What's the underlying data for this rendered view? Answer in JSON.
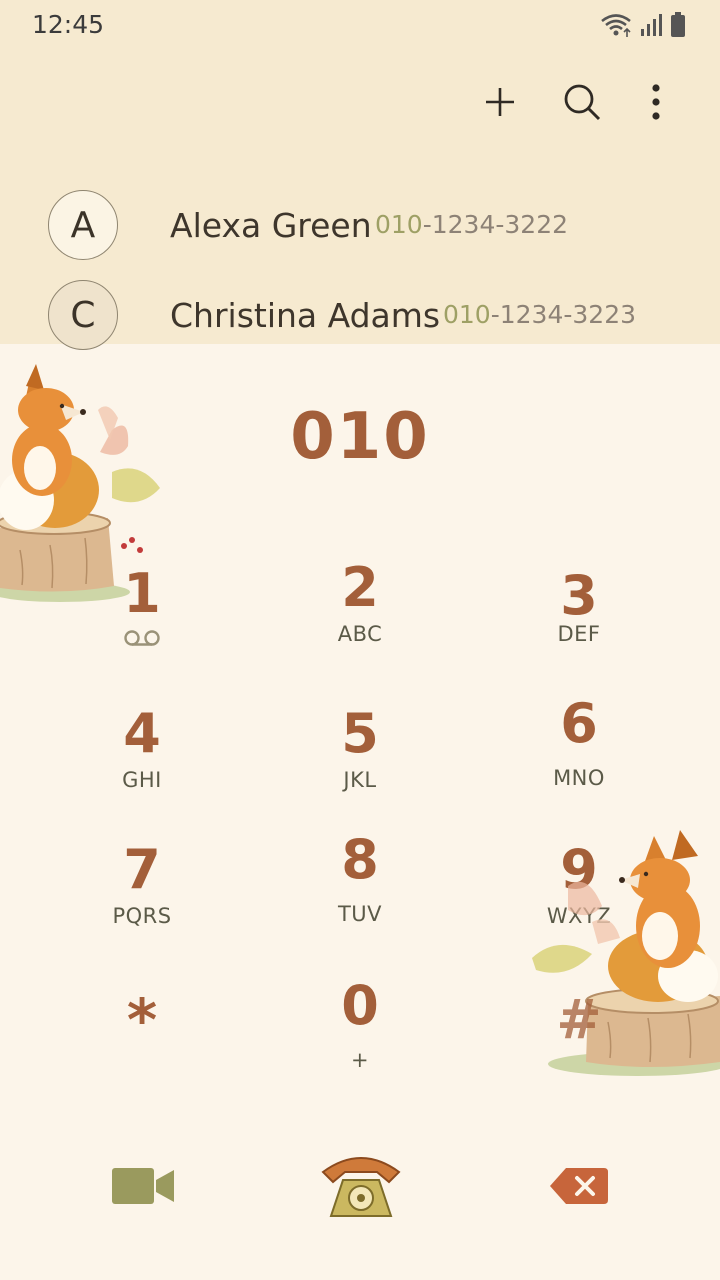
{
  "status_bar": {
    "time": "12:45",
    "icons": [
      "wifi-icon",
      "signal-icon",
      "battery-icon"
    ]
  },
  "toolbar": {
    "icons": [
      "add-icon",
      "search-icon",
      "more-vert-icon"
    ]
  },
  "contacts": [
    {
      "initial": "A",
      "name": "Alexa Green",
      "number_match": "010",
      "number_rest": "-1234-3222"
    },
    {
      "initial": "C",
      "name": "Christina Adams",
      "number_match": "010",
      "number_rest": "-1234-3223"
    }
  ],
  "dialer": {
    "display": "010",
    "keys": [
      {
        "digit": "1",
        "letters": ""
      },
      {
        "digit": "2",
        "letters": "ABC"
      },
      {
        "digit": "3",
        "letters": "DEF"
      },
      {
        "digit": "4",
        "letters": "GHI"
      },
      {
        "digit": "5",
        "letters": "JKL"
      },
      {
        "digit": "6",
        "letters": "MNO"
      },
      {
        "digit": "7",
        "letters": "PQRS"
      },
      {
        "digit": "8",
        "letters": "TUV"
      },
      {
        "digit": "9",
        "letters": "WXYZ"
      },
      {
        "digit": "*",
        "letters": ""
      },
      {
        "digit": "0",
        "letters": "+"
      },
      {
        "digit": "#",
        "letters": ""
      }
    ]
  },
  "bottom_bar": {
    "icons": [
      "video-call-icon",
      "phone-call-icon",
      "backspace-icon"
    ]
  },
  "colors": {
    "accent": "#a35f3a",
    "header_bg": "#f6ead0",
    "body_bg": "#fcf5ea",
    "match_highlight": "#9ea065",
    "video_icon": "#9a9a5e"
  }
}
